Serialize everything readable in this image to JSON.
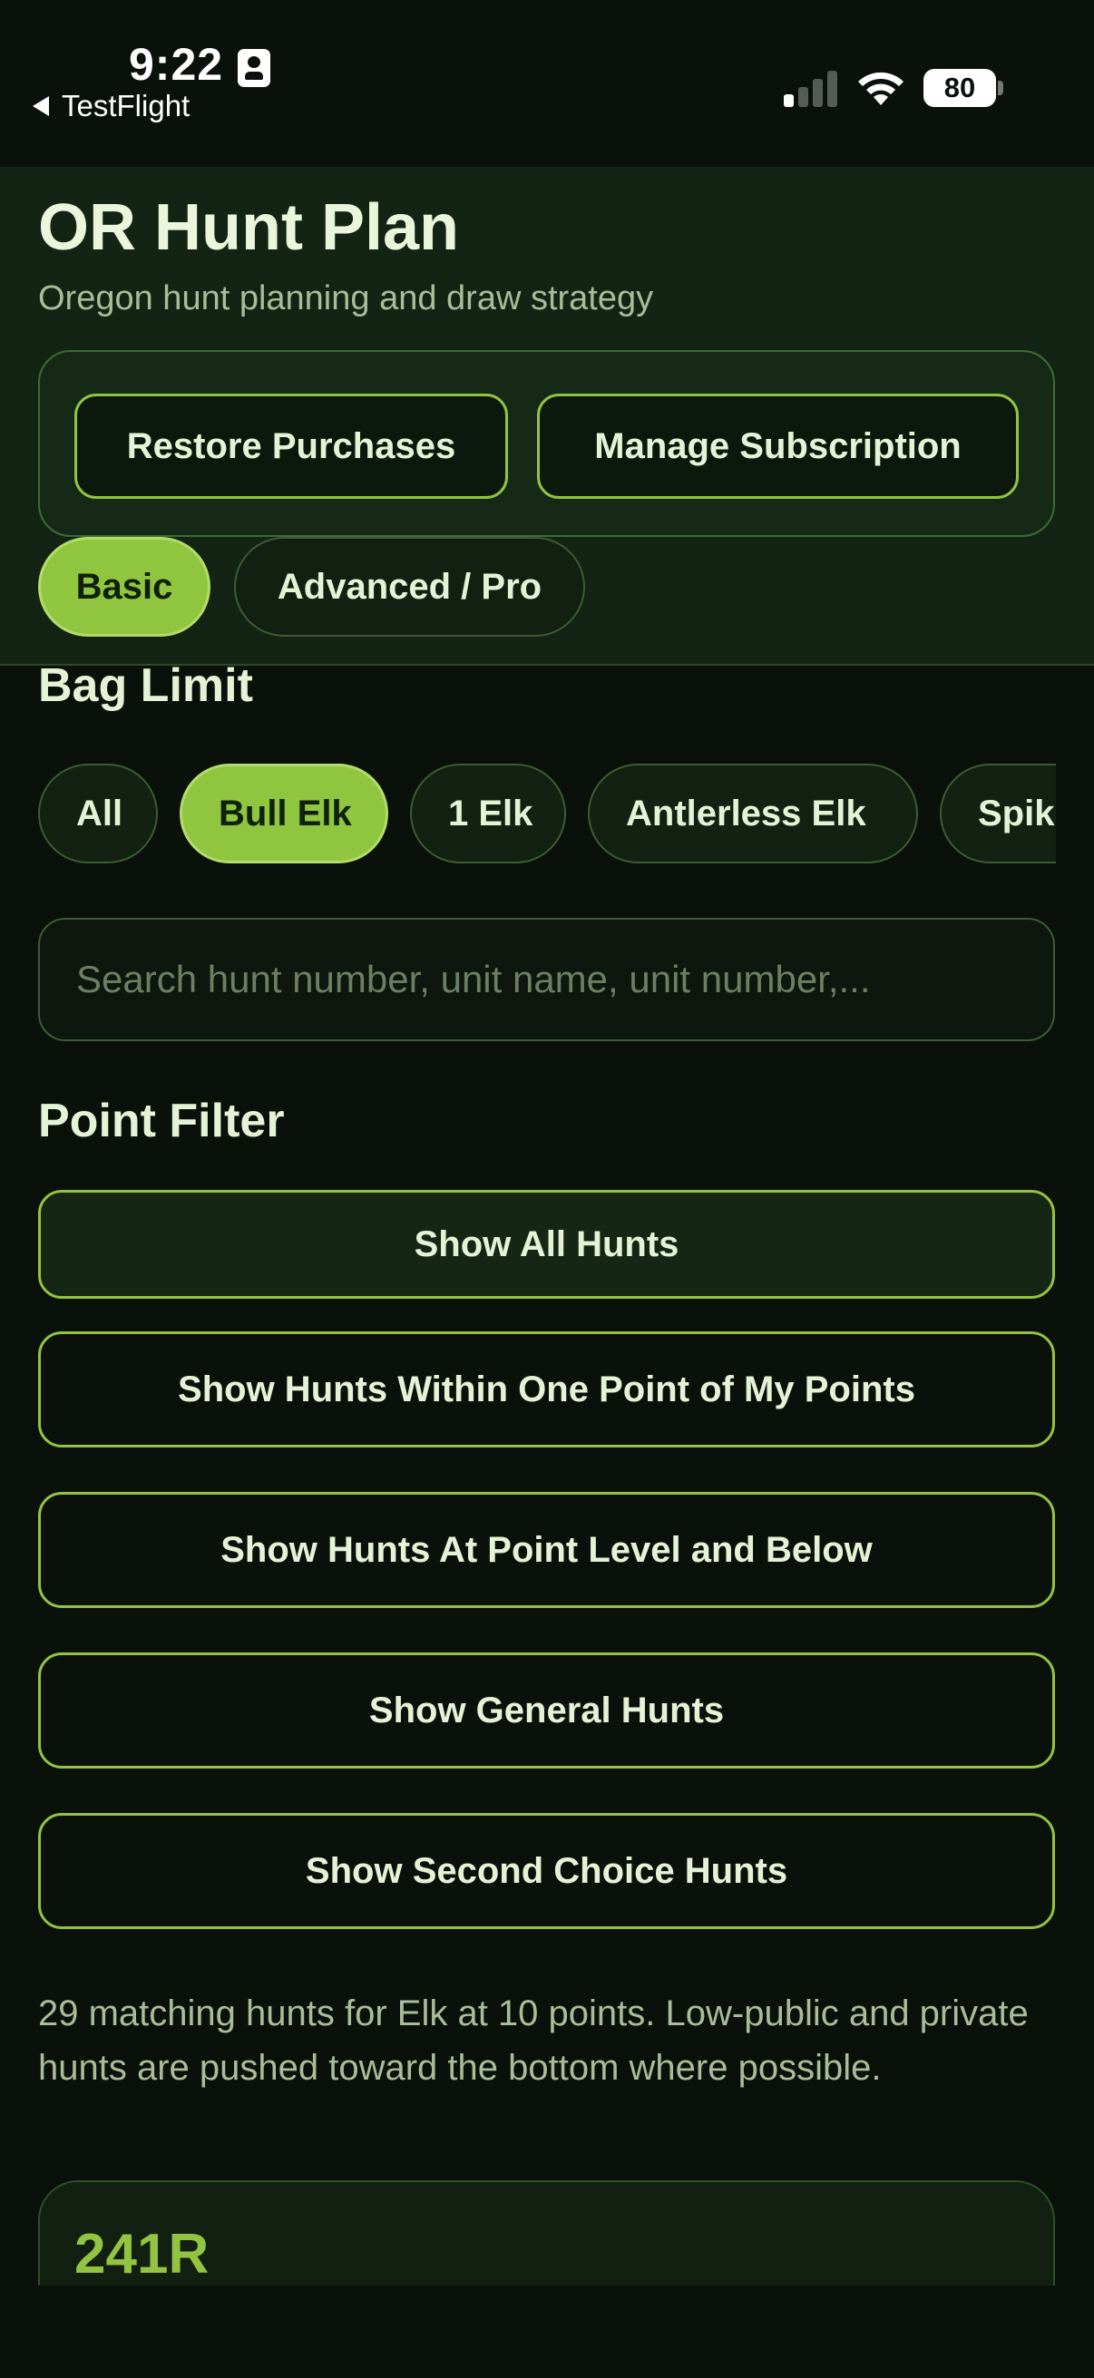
{
  "status_bar": {
    "time": "9:22",
    "back_label": "TestFlight",
    "battery": "80",
    "icons": [
      "id-card-icon",
      "signal-icon",
      "wifi-icon",
      "battery-icon"
    ]
  },
  "header": {
    "title": "OR Hunt Plan",
    "subtitle": "Oregon hunt planning and draw strategy",
    "restore_label": "Restore Purchases",
    "manage_label": "Manage Subscription",
    "modes": [
      {
        "label": "Basic",
        "active": true
      },
      {
        "label": "Advanced / Pro",
        "active": false
      }
    ]
  },
  "bag_limit": {
    "title": "Bag Limit",
    "chips": [
      {
        "label": "All",
        "active": false
      },
      {
        "label": "Bull Elk",
        "active": true
      },
      {
        "label": "1 Elk",
        "active": false
      },
      {
        "label": "Antlerless Elk",
        "active": false
      },
      {
        "label": "Spik",
        "active": false
      }
    ]
  },
  "search": {
    "placeholder": "Search hunt number, unit name, unit number,...",
    "value": ""
  },
  "point_filter": {
    "title": "Point Filter",
    "options": [
      {
        "label": "Show All Hunts",
        "active": true
      },
      {
        "label": "Show Hunts Within One Point of My Points",
        "active": false
      },
      {
        "label": "Show Hunts At Point Level and Below",
        "active": false
      },
      {
        "label": "Show General Hunts",
        "active": false
      },
      {
        "label": "Show Second Choice Hunts",
        "active": false
      }
    ]
  },
  "results": {
    "summary": "29 matching hunts for Elk at 10 points. Low-public and private hunts are pushed toward the bottom where possible.",
    "first_hunt_code": "241R"
  },
  "colors": {
    "background": "#0a110a",
    "header_panel": "#142414",
    "accent": "#8fc53f",
    "accent_border": "#93c341",
    "text": "#e4f2d6",
    "muted_text": "#a9bd98"
  }
}
